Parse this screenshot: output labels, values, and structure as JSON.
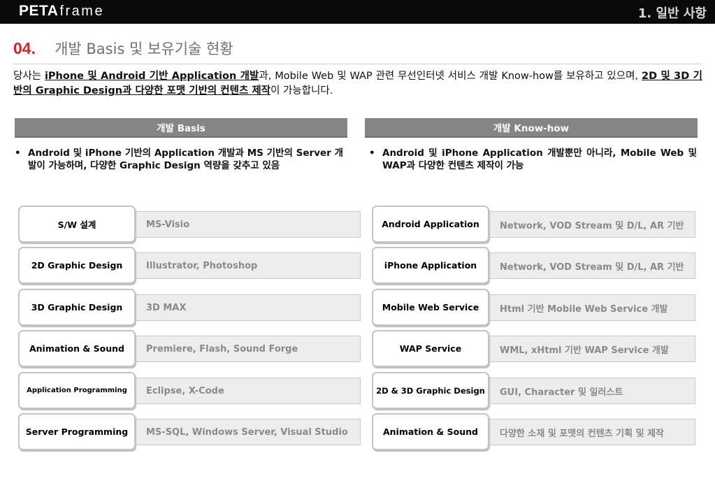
{
  "header": {
    "brand_bold": "PETA",
    "brand_light": "frame",
    "section": "1. 일반 사항"
  },
  "title": {
    "number": "04.",
    "text": "개발 Basis 및 보유기술 현황"
  },
  "intro": {
    "p1": "당사는 ",
    "b1": "iPhone 및 Android 기반 Application 개발",
    "p2": "과, Mobile Web 및 WAP 관련 무선인터넷 서비스 개발 Know-how를 보유하고 있으며, ",
    "b2": "2D 및 3D 기반의 Graphic Design과 다양한 포맷 기반의 컨텐츠 제작",
    "p3": "이 가능합니다."
  },
  "left": {
    "header": "개발 Basis",
    "bullet": "•",
    "description": "Android 및 iPhone 기반의 Application 개발과 MS 기반의 Server 개발이 가능하며, 다양한 Graphic Design 역량을 갖추고 있음",
    "rows": [
      {
        "label": "S/W 설계",
        "value": "MS-Visio"
      },
      {
        "label": "2D Graphic Design",
        "value": "Illustrator, Photoshop"
      },
      {
        "label": "3D Graphic Design",
        "value": "3D MAX"
      },
      {
        "label": "Animation & Sound",
        "value": "Premiere, Flash, Sound Forge"
      },
      {
        "label": "Application Programming",
        "value": "Eclipse, X-Code"
      },
      {
        "label": "Server Programming",
        "value": "MS-SQL, Windows Server, Visual Studio"
      }
    ]
  },
  "right": {
    "header": "개발 Know-how",
    "bullet": "•",
    "description": "Android 및 iPhone Application 개발뿐만 아니라, Mobile Web 및 WAP과 다양한 컨텐츠 제작이 가능",
    "rows": [
      {
        "label": "Android Application",
        "value": "Network, VOD Stream 및 D/L, AR 기반"
      },
      {
        "label": "iPhone Application",
        "value": "Network, VOD Stream 및 D/L, AR 기반"
      },
      {
        "label": "Mobile Web Service",
        "value": "Html 기반 Mobile Web Service 개발"
      },
      {
        "label": "WAP Service",
        "value": "WML, xHtml 기반 WAP Service 개발"
      },
      {
        "label": "2D & 3D Graphic Design",
        "value": "GUI, Character 및 일러스트"
      },
      {
        "label": "Animation & Sound",
        "value": "다양한 소재 및 포맷의 컨텐츠 기획 및 제작"
      }
    ]
  }
}
